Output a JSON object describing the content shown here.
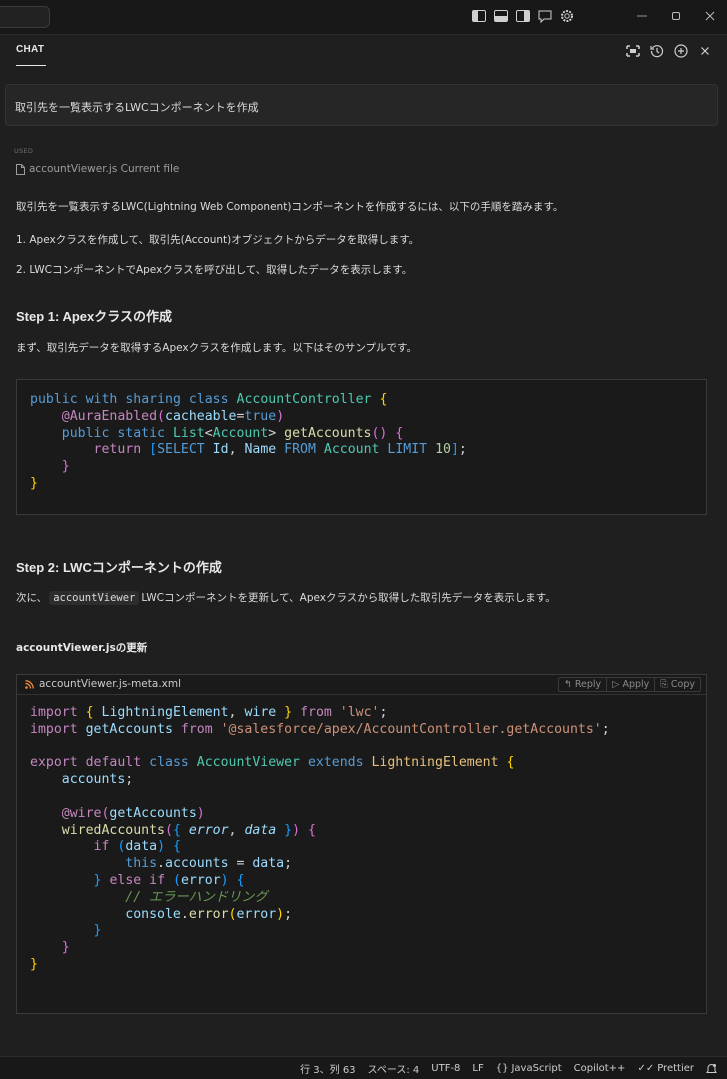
{
  "chat": {
    "title": "CHAT",
    "prompt": "取引先を一覧表示するLWCコンポーネントを作成",
    "used_label": "USED",
    "used_file": "accountViewer.js Current file",
    "intro": "取引先を一覧表示するLWC(Lightning Web Component)コンポーネントを作成するには、以下の手順を踏みます。",
    "steps_list": [
      "1. Apexクラスを作成して、取引先(Account)オブジェクトからデータを取得します。",
      "2. LWCコンポーネントでApexクラスを呼び出して、取得したデータを表示します。"
    ],
    "step1_heading": "Step 1: Apexクラスの作成",
    "step1_text": "まず、取引先データを取得するApexクラスを作成します。以下はそのサンプルです。",
    "step2_heading": "Step 2: LWCコンポーネントの作成",
    "step2_text_prefix": "次に、",
    "step2_inline_code": "accountViewer",
    "step2_text_suffix": "LWCコンポーネントを更新して、Apexクラスから取得した取引先データを表示します。",
    "js_update_heading": "accountViewer.jsの更新",
    "code2_filename": "accountViewer.js-meta.xml",
    "code_actions": {
      "reply": "Reply",
      "apply": "Apply",
      "copy": "Copy"
    }
  },
  "code_blocks": {
    "apex": [
      "public with sharing class AccountController {",
      "    @AuraEnabled(cacheable=true)",
      "    public static List<Account> getAccounts() {",
      "        return [SELECT Id, Name FROM Account LIMIT 10];",
      "    }",
      "}"
    ],
    "js": [
      "import { LightningElement, wire } from 'lwc';",
      "import getAccounts from '@salesforce/apex/AccountController.getAccounts';",
      "",
      "export default class AccountViewer extends LightningElement {",
      "    accounts;",
      "",
      "    @wire(getAccounts)",
      "    wiredAccounts({ error, data }) {",
      "        if (data) {",
      "            this.accounts = data;",
      "        } else if (error) {",
      "            // エラーハンドリング",
      "            console.error(error);",
      "        }",
      "    }",
      "}"
    ]
  },
  "statusbar": {
    "position": "行 3、列 63",
    "spaces": "スペース: 4",
    "encoding": "UTF-8",
    "eol": "LF",
    "language": "JavaScript",
    "copilot": "Copilot++",
    "prettier": "Prettier"
  },
  "icons": {
    "titlebar": [
      "toggle-sidebar-icon",
      "toggle-panel-icon",
      "toggle-secondary-sidebar-icon",
      "chat-icon",
      "settings-gear-icon"
    ],
    "window": [
      "minimize-icon",
      "restore-icon",
      "close-icon"
    ],
    "chat": [
      "maximize-icon",
      "history-icon",
      "new-chat-icon",
      "close-icon"
    ]
  },
  "colors": {
    "background": "#1f1f1f",
    "keyword": "#569cd6",
    "type": "#4ec9b0",
    "function": "#dcdcaa",
    "string": "#ce9178",
    "comment": "#6a9955"
  }
}
